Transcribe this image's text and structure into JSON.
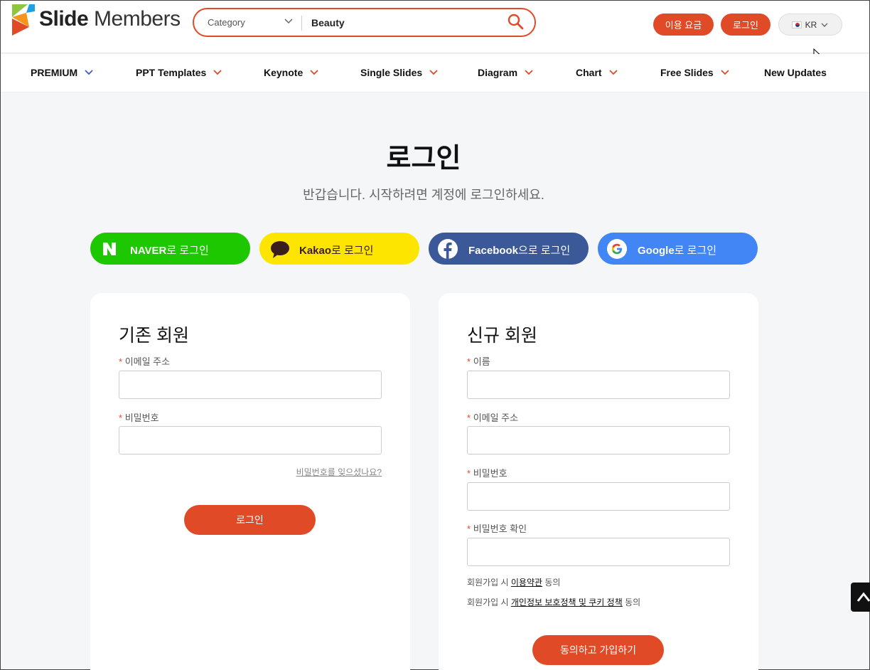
{
  "header": {
    "logo_bold": "Slide",
    "logo_light": " Members",
    "search": {
      "category": "Category",
      "query": "Beauty"
    },
    "pricing_label": "이용 요금",
    "login_label": "로그인",
    "lang_label": "KR"
  },
  "nav": {
    "items": [
      {
        "label": "PREMIUM"
      },
      {
        "label": "PPT Templates"
      },
      {
        "label": "Keynote"
      },
      {
        "label": "Single Slides"
      },
      {
        "label": "Diagram"
      },
      {
        "label": "Chart"
      },
      {
        "label": "Free Slides"
      },
      {
        "label": "New Updates"
      }
    ]
  },
  "page": {
    "title": "로그인",
    "subtitle": "반갑습니다. 시작하려면 계정에 로그인하세요."
  },
  "social": {
    "naver": {
      "brand": "NAVER",
      "suffix": "로 로그인",
      "color": "#1ec800"
    },
    "kakao": {
      "brand": "Kakao",
      "suffix": "로 로그인",
      "color": "#fee500"
    },
    "facebook": {
      "brand": "Facebook",
      "suffix": "으로 로그인",
      "color": "#3b5998"
    },
    "google": {
      "brand": "Google",
      "suffix": "로 로그인",
      "color": "#4285f4"
    }
  },
  "existing": {
    "heading": "기존 회원",
    "email_label": "이메일 주소",
    "password_label": "비밀번호",
    "forgot_label": "비밀번호를 잊으셨나요?",
    "submit_label": "로그인"
  },
  "signup": {
    "heading": "신규 회원",
    "name_label": "이름",
    "email_label": "이메일 주소",
    "password_label": "비밀번호",
    "confirm_label": "비밀번호 확인",
    "terms_prefix": "회원가입 시 ",
    "terms_link": "이용약관",
    "terms_suffix": " 동의",
    "privacy_prefix": "회원가입 시 ",
    "privacy_link": "개인정보 보호정책 및 쿠키 정책",
    "privacy_suffix": " 동의",
    "submit_label": "동의하고 가입하기"
  },
  "required_mark": "*",
  "colors": {
    "accent": "#e04a26"
  }
}
